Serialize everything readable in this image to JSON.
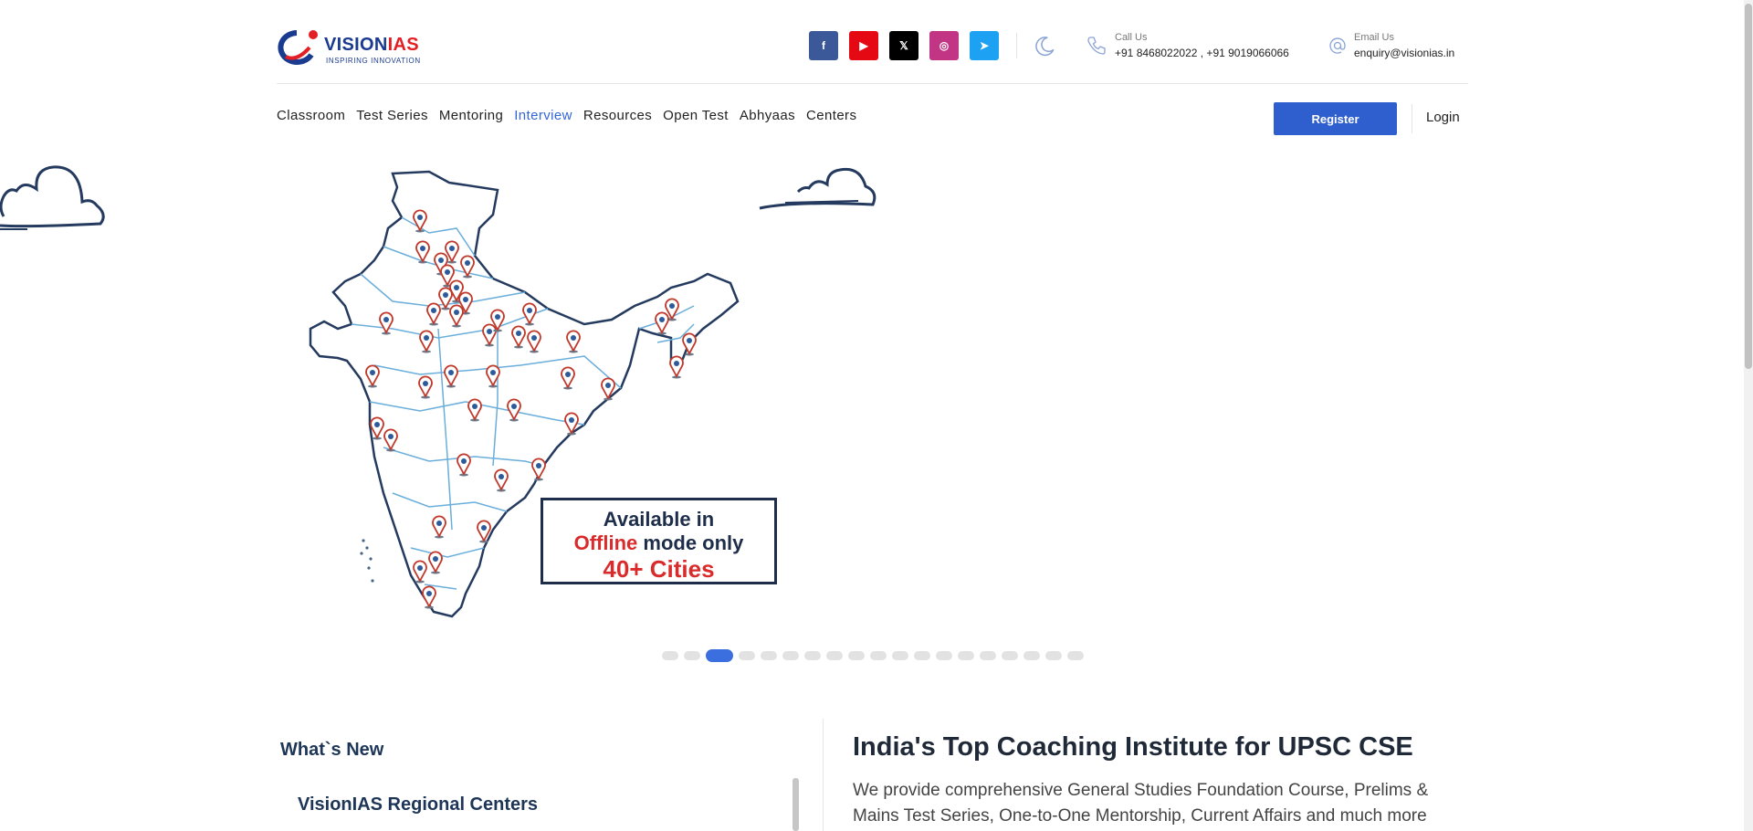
{
  "brand": {
    "name_part1": "VISION",
    "name_part2": "IAS",
    "tagline": "INSPIRING INNOVATION"
  },
  "social": [
    {
      "name": "facebook",
      "glyph": "f",
      "color": "#3b5998"
    },
    {
      "name": "youtube",
      "glyph": "▶",
      "color": "#e50914"
    },
    {
      "name": "x",
      "glyph": "𝕏",
      "color": "#000000"
    },
    {
      "name": "instagram",
      "glyph": "◎",
      "color": "#c13584"
    },
    {
      "name": "telegram",
      "glyph": "➤",
      "color": "#1da1f2"
    }
  ],
  "contact": {
    "call_label": "Call Us",
    "call_value": "+91 8468022022 , +91 9019066066",
    "email_label": "Email Us",
    "email_value": "enquiry@visionias.in"
  },
  "nav": {
    "items": [
      "Classroom",
      "Test Series",
      "Mentoring",
      "Interview",
      "Resources",
      "Open Test",
      "Abhyaas",
      "Centers"
    ],
    "active": "Interview",
    "register": "Register",
    "login": "Login"
  },
  "hero": {
    "line1": "Available in",
    "line2_red": "Offline",
    "line2_rest": " mode only",
    "line3": "40+ Cities",
    "slides_total": 19,
    "active_slide": 3
  },
  "whats_new": {
    "heading": "What`s New",
    "item_title": "VisionIAS Regional Centers"
  },
  "intro": {
    "title": "India's Top Coaching Institute for UPSC CSE",
    "desc": "We provide comprehensive General Studies Foundation Course, Prelims & Mains Test Series, One-to-One Mentorship, Current Affairs and much more"
  },
  "colors": {
    "accent": "#2f5fcf",
    "brand_red": "#e31e24",
    "brand_blue": "#1a3b8f"
  }
}
